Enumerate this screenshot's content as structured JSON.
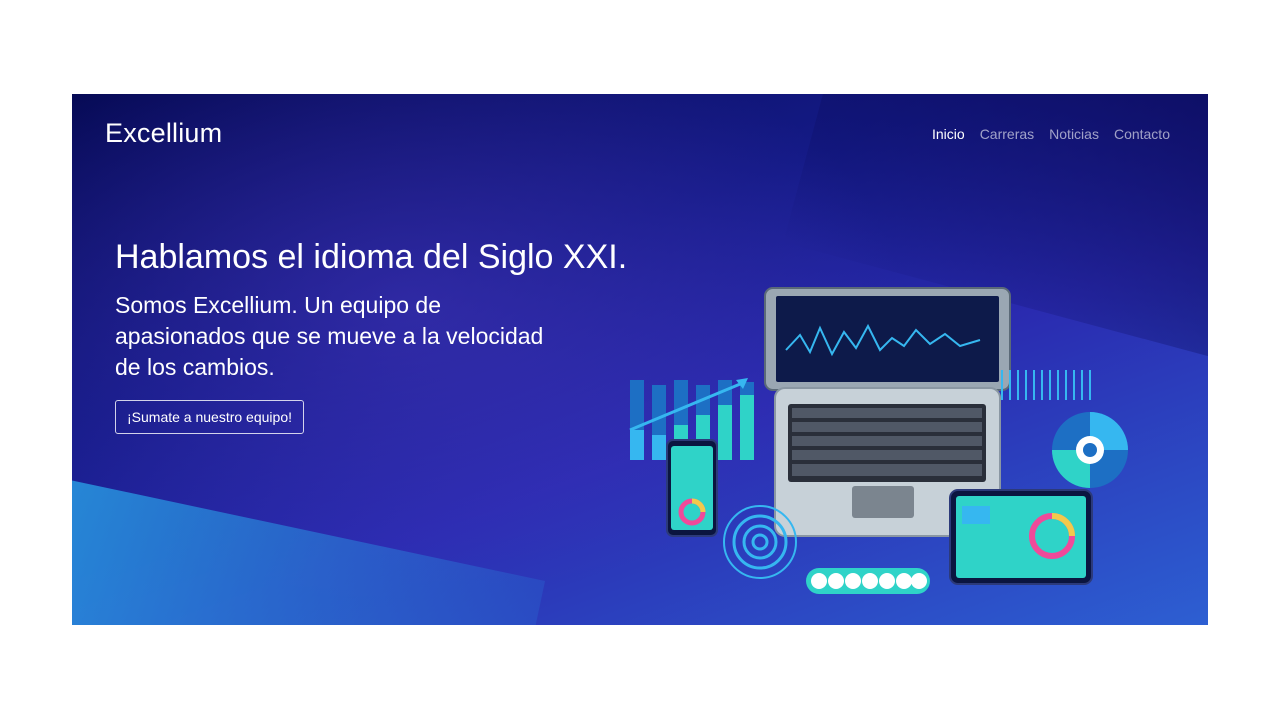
{
  "brand": {
    "name": "Excellium"
  },
  "nav": {
    "items": [
      {
        "label": "Inicio",
        "active": true
      },
      {
        "label": "Carreras",
        "active": false
      },
      {
        "label": "Noticias",
        "active": false
      },
      {
        "label": "Contacto",
        "active": false
      }
    ]
  },
  "hero": {
    "headline": "Hablamos el idioma del Siglo XXI.",
    "lead": "Somos Excellium. Un equipo de apasionados que se mueve a la velocidad de los cambios.",
    "cta_label": "¡Sumate a nuestro equipo!"
  },
  "illustration": {
    "icon": "analytics-devices-illustration",
    "colors": {
      "teal": "#2fd3c8",
      "cyan": "#36b7f0",
      "pink": "#f04a9a",
      "yellow": "#f2c94c"
    }
  }
}
